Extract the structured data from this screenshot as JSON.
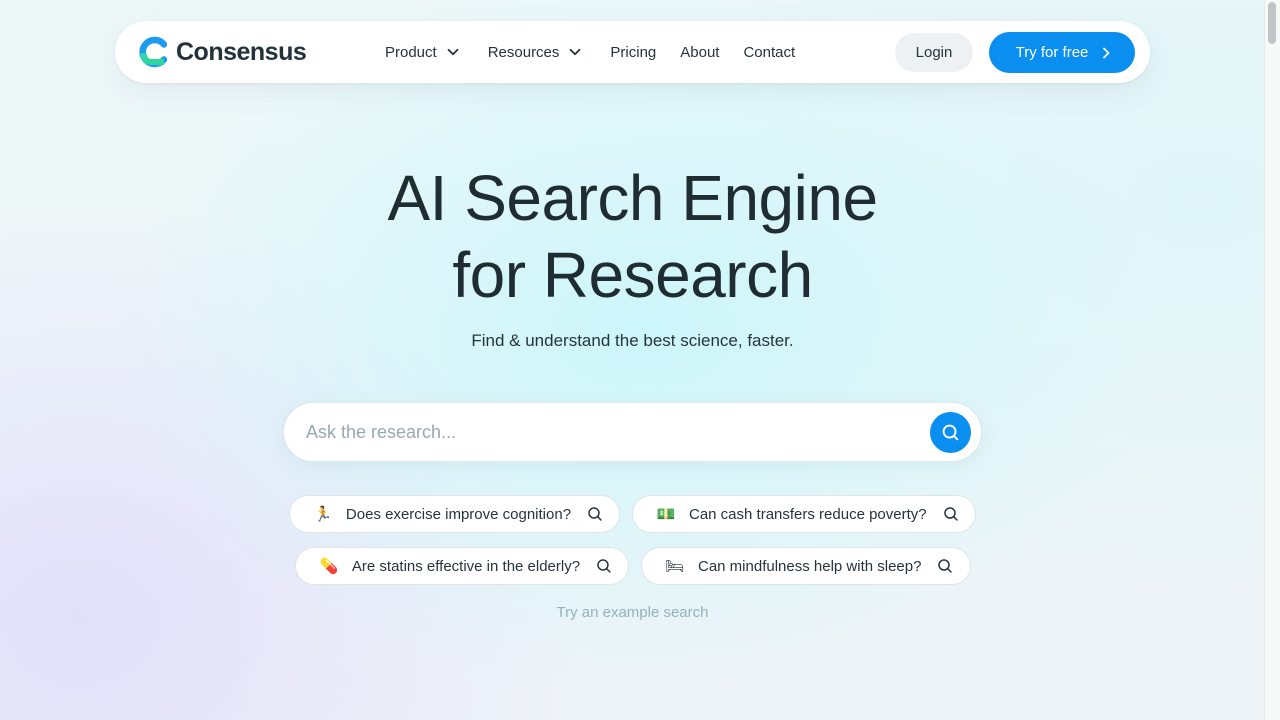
{
  "brand": {
    "name": "Consensus",
    "colors": {
      "accent": "#0a8ff0",
      "logo_green": "#2ed6a0",
      "logo_blue": "#1c9bf0",
      "text": "#1f2d33"
    }
  },
  "nav": {
    "links": [
      {
        "label": "Product",
        "has_dropdown": true,
        "icon": "chevron-down-icon"
      },
      {
        "label": "Resources",
        "has_dropdown": true,
        "icon": "chevron-down-icon"
      },
      {
        "label": "Pricing",
        "has_dropdown": false
      },
      {
        "label": "About",
        "has_dropdown": false
      },
      {
        "label": "Contact",
        "has_dropdown": false
      }
    ],
    "login_label": "Login",
    "cta_label": "Try for free",
    "cta_icon": "chevron-right-icon"
  },
  "hero": {
    "title_line1": "AI Search Engine",
    "title_line2": "for Research",
    "subtitle": "Find & understand the best science, faster."
  },
  "search": {
    "placeholder": "Ask the research...",
    "value": "",
    "button_icon": "search-icon"
  },
  "examples": {
    "chips": [
      {
        "emoji": "🏃",
        "icon": "running-person-icon",
        "text": "Does exercise improve cognition?"
      },
      {
        "emoji": "💵",
        "icon": "cash-icon",
        "text": "Can cash transfers reduce poverty?"
      },
      {
        "emoji": "💊",
        "icon": "pill-icon",
        "text": "Are statins effective in the elderly?"
      },
      {
        "emoji": "🛏",
        "icon": "bed-icon",
        "text": "Can mindfulness help with sleep?"
      }
    ],
    "hint": "Try an example search"
  }
}
